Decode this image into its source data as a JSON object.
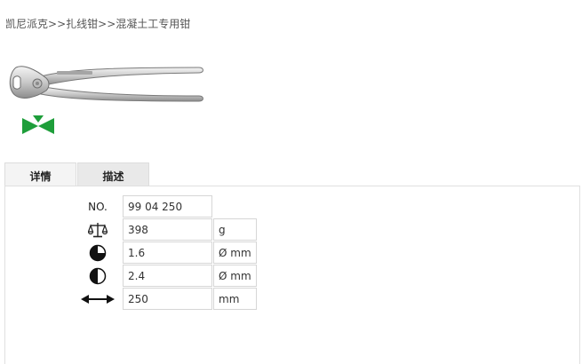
{
  "breadcrumb": {
    "items": [
      "凯尼派克",
      "扎线钳",
      "混凝土工专用钳"
    ],
    "separator": ">>"
  },
  "product": {
    "image_icon": "pliers-image",
    "badge_icon": "green-bowtie-badge-icon",
    "badge_color": "#1e9e3a"
  },
  "tabs": [
    {
      "label": "详情",
      "active": true
    },
    {
      "label": "描述",
      "active": false
    }
  ],
  "specs": {
    "number": {
      "label": "NO.",
      "value": "99 04 250"
    },
    "weight": {
      "icon": "scale-icon",
      "value": "398",
      "unit": "g"
    },
    "cut_hard": {
      "icon": "three-quarter-circle-icon",
      "value": "1.6",
      "unit": "Ø mm"
    },
    "cut_medium": {
      "icon": "half-circle-icon",
      "value": "2.4",
      "unit": "Ø mm"
    },
    "length": {
      "icon": "double-arrow-icon",
      "value": "250",
      "unit": "mm"
    }
  }
}
